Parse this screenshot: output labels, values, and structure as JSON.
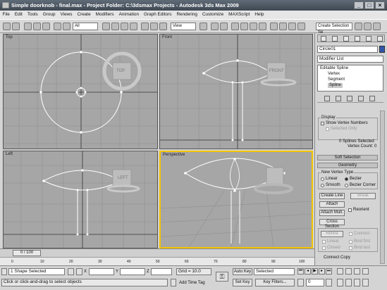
{
  "title": "Simple doorknob - final.max    - Project Folder: C:\\3dsmax Projects    - Autodesk 3ds Max  2009",
  "window_buttons": [
    "_",
    "□",
    "×"
  ],
  "menu": [
    "File",
    "Edit",
    "Tools",
    "Group",
    "Views",
    "Create",
    "Modifiers",
    "Animation",
    "Graph Editors",
    "Rendering",
    "Customize",
    "MAXScript",
    "Help"
  ],
  "toolbar": {
    "filter": "All",
    "ref_coord": "View",
    "selection_set": "Create Selection Se"
  },
  "viewports": {
    "top": "Top",
    "front": "Front",
    "left": "Left",
    "perspective": "Perspective"
  },
  "viewcube": {
    "top": "TOP",
    "front": "FRONT",
    "left": "LEFT"
  },
  "command_panel": {
    "object_name": "Circle01",
    "modifier_list": "Modifier List",
    "stack": [
      "Editable Spline",
      "Vertex",
      "Segment",
      "Spline"
    ],
    "display": {
      "title": "Display",
      "show_vertex_numbers": "Show Vertex Numbers",
      "selected_only": "Selected Only"
    },
    "selection_info": [
      "0 Splines Selected",
      "Vertex Count: 0"
    ],
    "soft_selection": "Soft Selection",
    "geometry": "Geometry",
    "new_vertex_type": "New Vertex Type",
    "vertex_types": [
      "Linear",
      "Bezier",
      "Smooth",
      "Bezier Corner"
    ],
    "create_line": "Create Line",
    "break": "Break",
    "attach": "Attach",
    "reorient": "Reorient",
    "attach_mult": "Attach Mult.",
    "cross_section": "Cross Section",
    "refine": "Refine",
    "connect": "Connect",
    "linear": "Linear",
    "bind_first": "Bind first",
    "closed": "Closed",
    "bind_last": "Bind last",
    "connect_copy": "Connect Copy"
  },
  "timeline": {
    "frame": "0 / 100",
    "ticks": [
      "0",
      "10",
      "20",
      "30",
      "40",
      "50",
      "60",
      "70",
      "80",
      "90",
      "100"
    ]
  },
  "status": {
    "selected": "1 Shape Selected",
    "prompt": "Click or click-and-drag to select objects",
    "x_label": "X",
    "y_label": "Y",
    "z_label": "Z",
    "grid": "Grid = 10.0",
    "add_time_tag": "Add Time Tag",
    "auto_key": "Auto Key",
    "set_key": "Set Key",
    "key_filters": "Key Filters...",
    "selected_dropdown": "Selected",
    "frame_field": "0"
  }
}
